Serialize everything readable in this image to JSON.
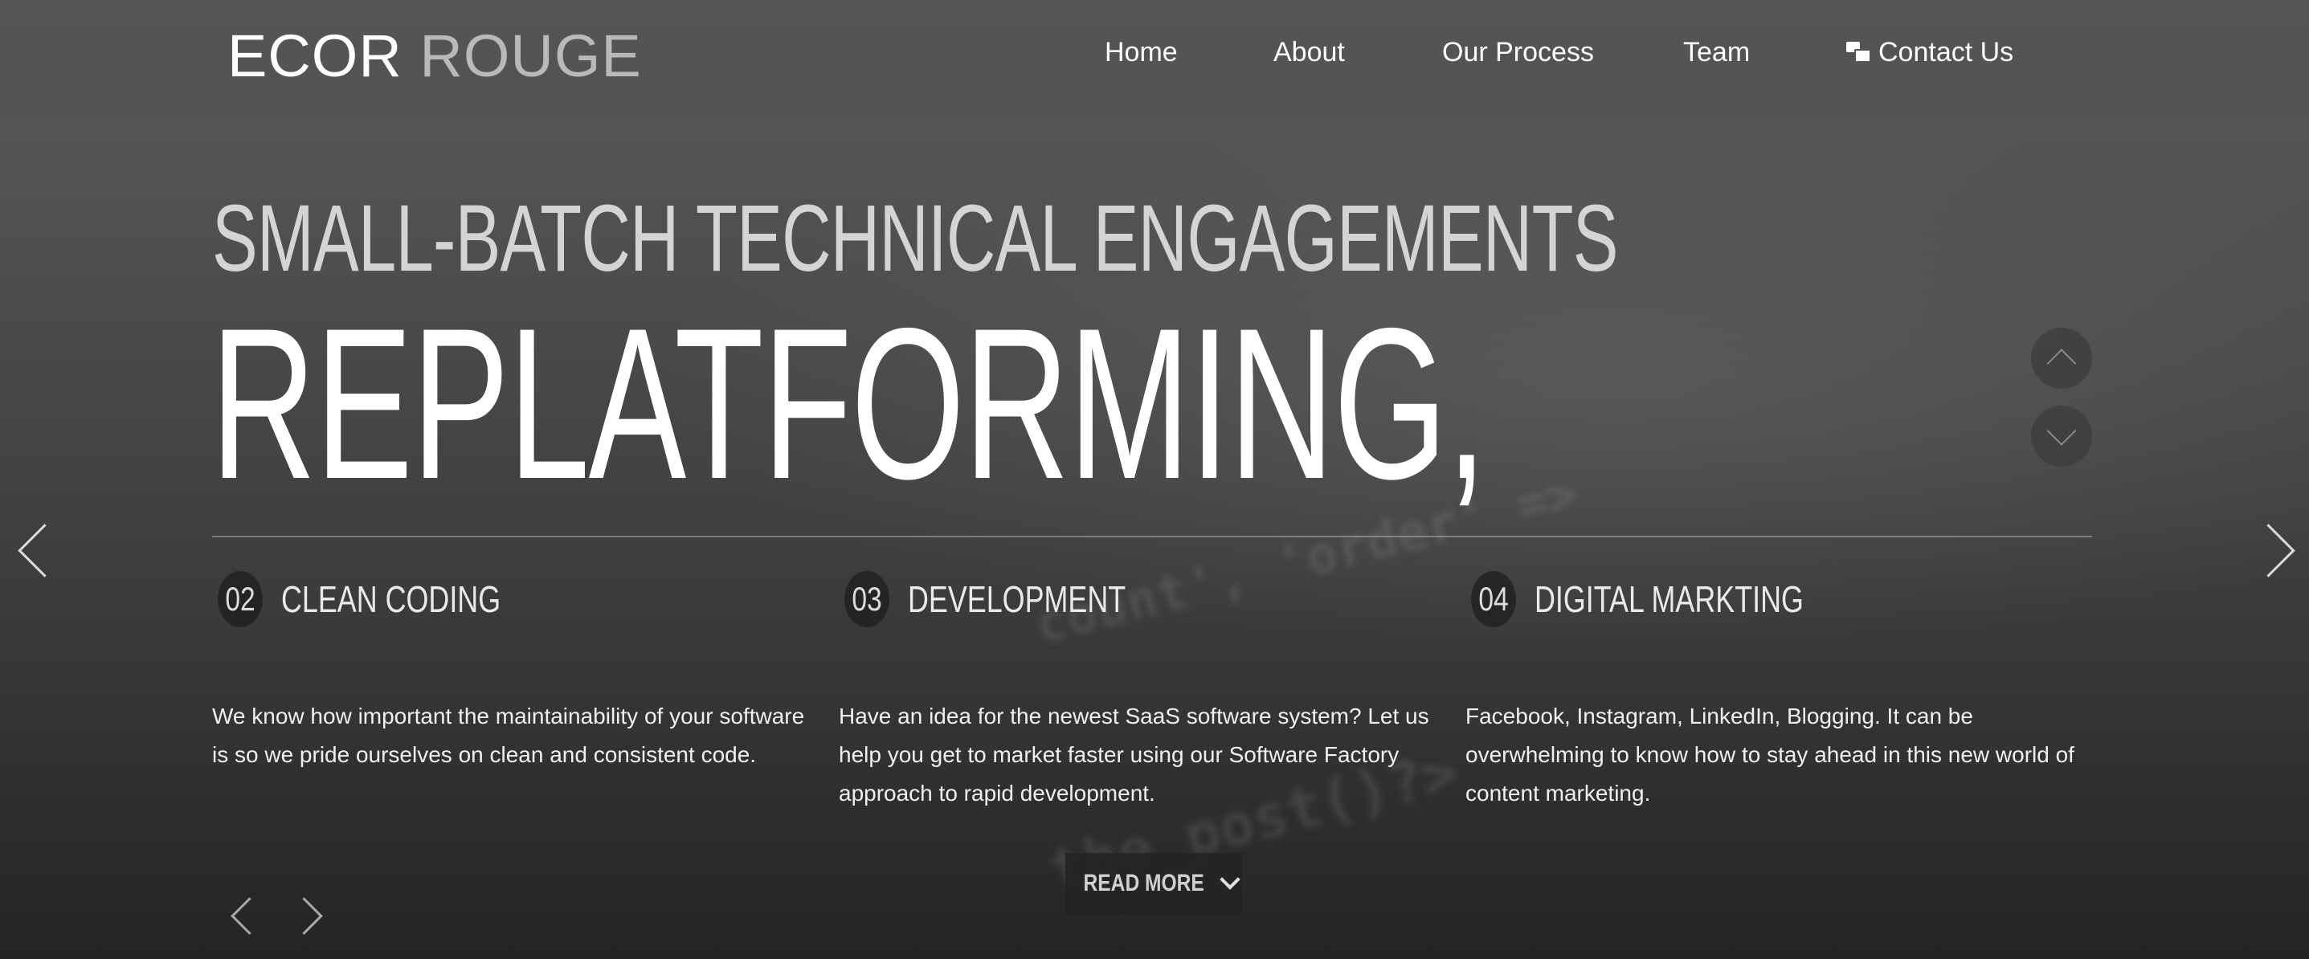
{
  "brand": {
    "part1": "ECOR",
    "part2": "ROUGE"
  },
  "nav": {
    "items": [
      {
        "label": "Home"
      },
      {
        "label": "About"
      },
      {
        "label": "Our Process"
      },
      {
        "label": "Team"
      },
      {
        "label": "Contact Us"
      }
    ]
  },
  "hero": {
    "kicker": "SMALL-BATCH TECHNICAL ENGAGEMENTS",
    "headline": "REPLATFORMING,"
  },
  "features": [
    {
      "number": "02",
      "title": "CLEAN CODING",
      "text": "We know how important the maintainability of your software is so we pride ourselves on clean and consistent code."
    },
    {
      "number": "03",
      "title": "DEVELOPMENT",
      "text": "Have an idea for the newest SaaS software system? Let us help you get to market faster using our Software Factory approach to rapid development."
    },
    {
      "number": "04",
      "title": "DIGITAL MARKTING",
      "text": "Facebook, Instagram, LinkedIn, Blogging. It can be overwhelming to know how to stay ahead in this new world of content marketing."
    }
  ],
  "read_more": {
    "label": "READ MORE"
  },
  "background_code": {
    "line1": "count', 'order' =>",
    "line2": "the_post()?>"
  },
  "colors": {
    "accent": "#ffffff",
    "muted": "#b9b9b9"
  }
}
